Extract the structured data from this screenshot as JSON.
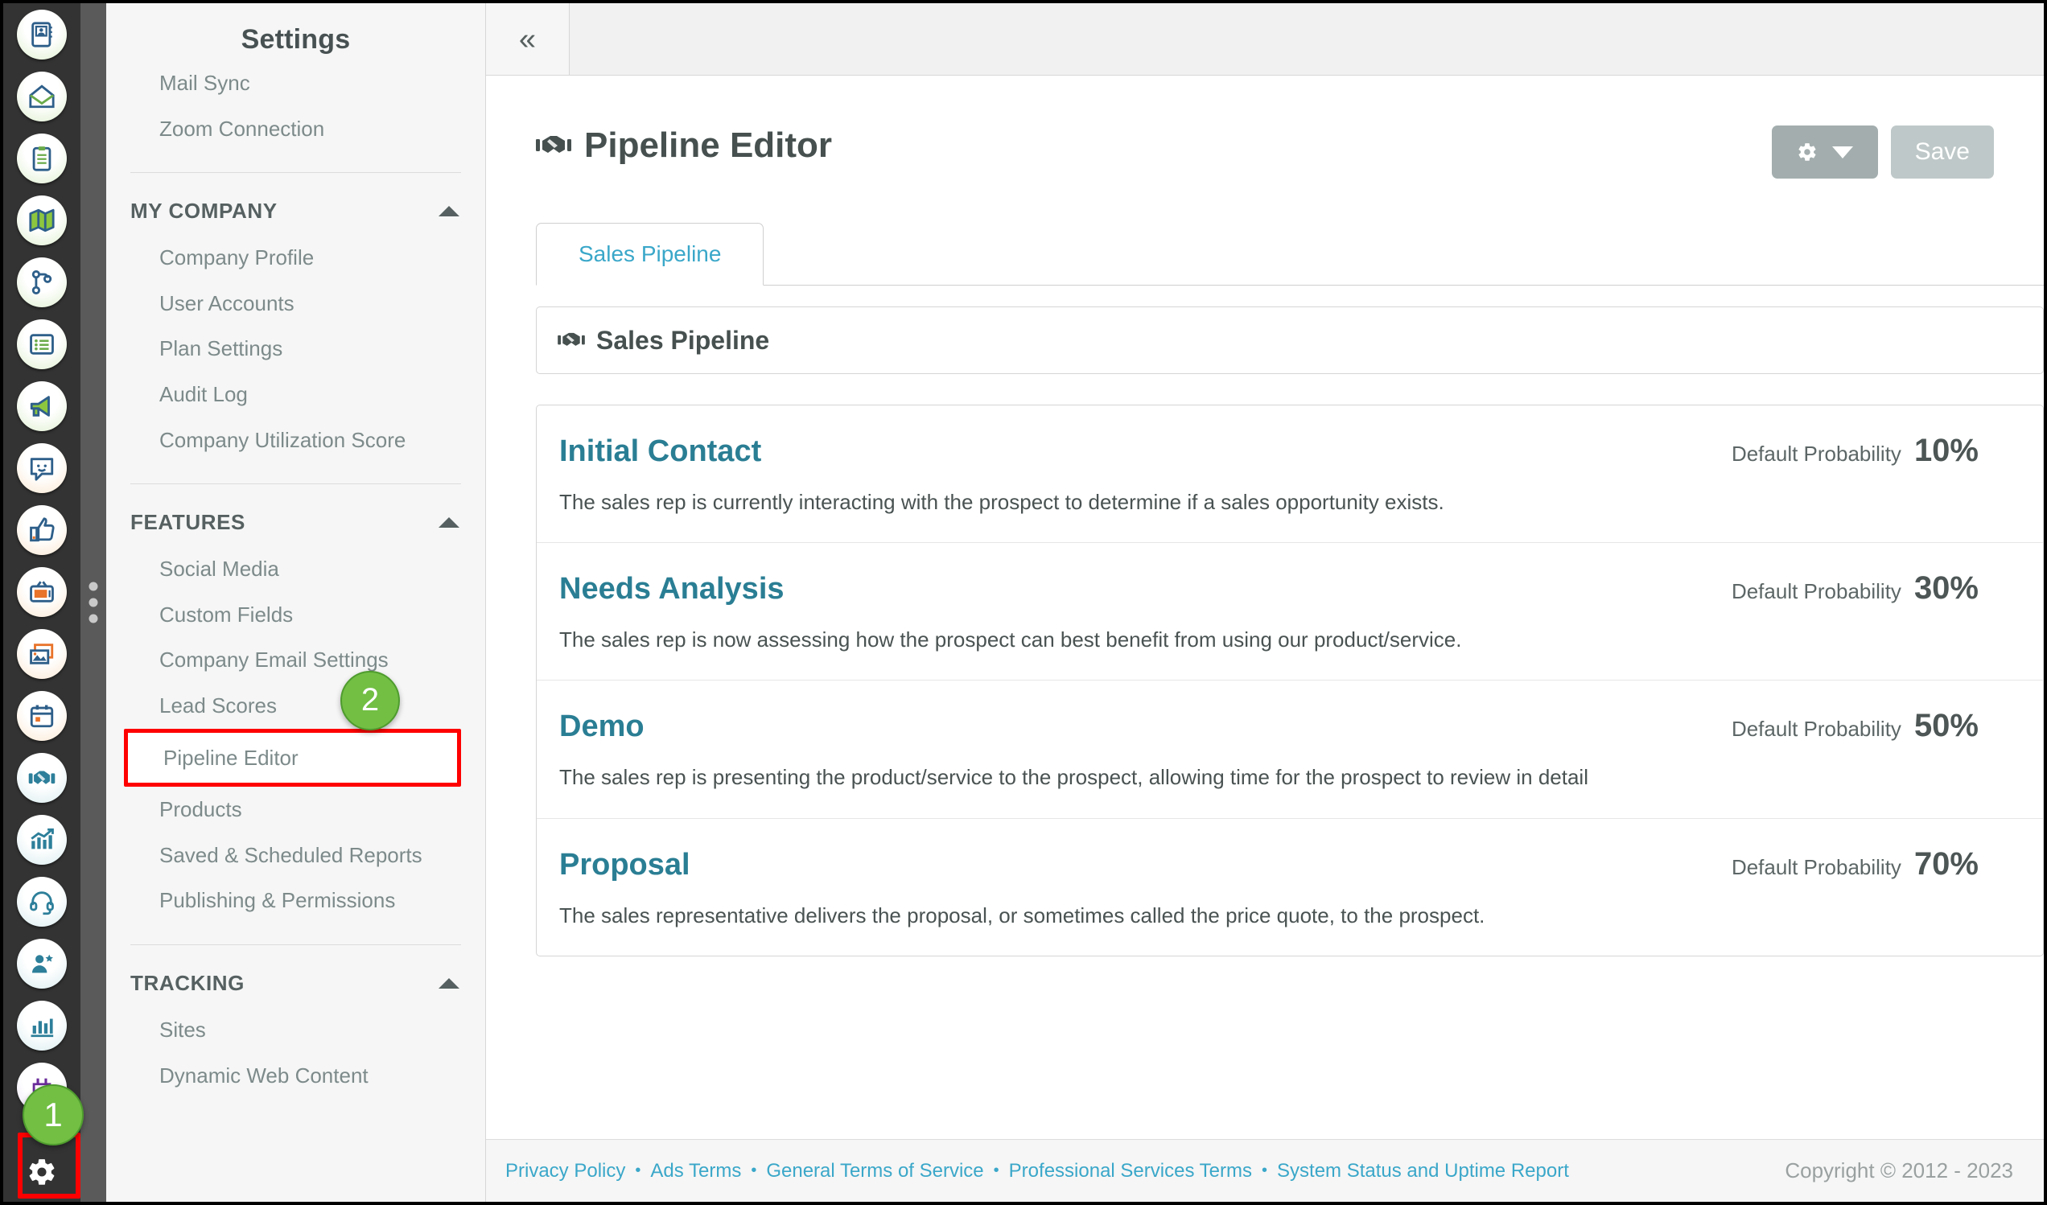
{
  "colors": {
    "accent_teal": "#2a7e94",
    "link_blue": "#3aa7c9",
    "badge_green": "#72bf44",
    "highlight_red": "#ff0000",
    "rail_dark": "#333333"
  },
  "rail": {
    "icons": [
      {
        "name": "contacts-icon",
        "tone": "green"
      },
      {
        "name": "email-open-icon",
        "tone": "green"
      },
      {
        "name": "clipboard-icon",
        "tone": "green"
      },
      {
        "name": "map-icon",
        "tone": "green"
      },
      {
        "name": "workflow-icon",
        "tone": "green"
      },
      {
        "name": "list-icon",
        "tone": "green"
      },
      {
        "name": "megaphone-icon",
        "tone": "green"
      },
      {
        "name": "chat-smile-icon",
        "tone": "orange"
      },
      {
        "name": "thumbs-up-icon",
        "tone": "orange"
      },
      {
        "name": "tv-icon",
        "tone": "orange"
      },
      {
        "name": "image-gallery-icon",
        "tone": "orange"
      },
      {
        "name": "calendar-icon",
        "tone": "orange"
      },
      {
        "name": "handshake-icon",
        "tone": "blue"
      },
      {
        "name": "growth-chart-icon",
        "tone": "blue"
      },
      {
        "name": "headset-icon",
        "tone": "blue"
      },
      {
        "name": "user-star-icon",
        "tone": "blue"
      },
      {
        "name": "bar-chart-icon",
        "tone": "blue"
      },
      {
        "name": "plug-robot-icon",
        "tone": "purple"
      }
    ],
    "gear_icon": "gear-icon",
    "badge_bottom": "1"
  },
  "settings_panel": {
    "title": "Settings",
    "top_items": [
      {
        "label": "Mail Sync"
      },
      {
        "label": "Zoom Connection"
      }
    ],
    "groups": [
      {
        "title": "MY COMPANY",
        "collapse_icon": "chevron-up-icon",
        "items": [
          {
            "label": "Company Profile"
          },
          {
            "label": "User Accounts"
          },
          {
            "label": "Plan Settings"
          },
          {
            "label": "Audit Log"
          },
          {
            "label": "Company Utilization Score"
          }
        ]
      },
      {
        "title": "FEATURES",
        "collapse_icon": "chevron-up-icon",
        "items": [
          {
            "label": "Social Media"
          },
          {
            "label": "Custom Fields"
          },
          {
            "label": "Company Email Settings"
          },
          {
            "label": "Lead Scores"
          },
          {
            "label": "Pipeline Editor",
            "highlighted": true,
            "badge": "2"
          },
          {
            "label": "Products"
          },
          {
            "label": "Saved & Scheduled Reports"
          },
          {
            "label": "Publishing & Permissions"
          }
        ]
      },
      {
        "title": "TRACKING",
        "collapse_icon": "chevron-up-icon",
        "items": [
          {
            "label": "Sites"
          },
          {
            "label": "Dynamic Web Content"
          }
        ]
      }
    ]
  },
  "topbar": {
    "collapse_label": "«",
    "collapse_icon": "chevron-double-left-icon"
  },
  "page": {
    "title": "Pipeline Editor",
    "title_icon": "handshake-icon",
    "gear_button_icon": "gear-icon",
    "gear_button_caret": "chevron-down-icon",
    "save_label": "Save",
    "tabs": [
      {
        "label": "Sales Pipeline",
        "active": true
      }
    ],
    "pipeline_name": "Sales Pipeline",
    "pipeline_name_icon": "handshake-icon",
    "probability_label": "Default Probability",
    "stages": [
      {
        "name": "Initial Contact",
        "probability": "10%",
        "description": "The sales rep is currently interacting with the prospect to determine if a sales opportunity exists."
      },
      {
        "name": "Needs Analysis",
        "probability": "30%",
        "description": "The sales rep is now assessing how the prospect can best benefit from using our product/service."
      },
      {
        "name": "Demo",
        "probability": "50%",
        "description": "The sales rep is presenting the product/service to the prospect, allowing time for the prospect to review in detail"
      },
      {
        "name": "Proposal",
        "probability": "70%",
        "description": "The sales representative delivers the proposal, or sometimes called the price quote, to the prospect."
      }
    ]
  },
  "footer": {
    "links": [
      {
        "label": "Privacy Policy"
      },
      {
        "label": "Ads Terms"
      },
      {
        "label": "General Terms of Service"
      },
      {
        "label": "Professional Services Terms"
      },
      {
        "label": "System Status and Uptime Report"
      }
    ],
    "separator": "•",
    "copyright": "Copyright © 2012 - 2023"
  }
}
